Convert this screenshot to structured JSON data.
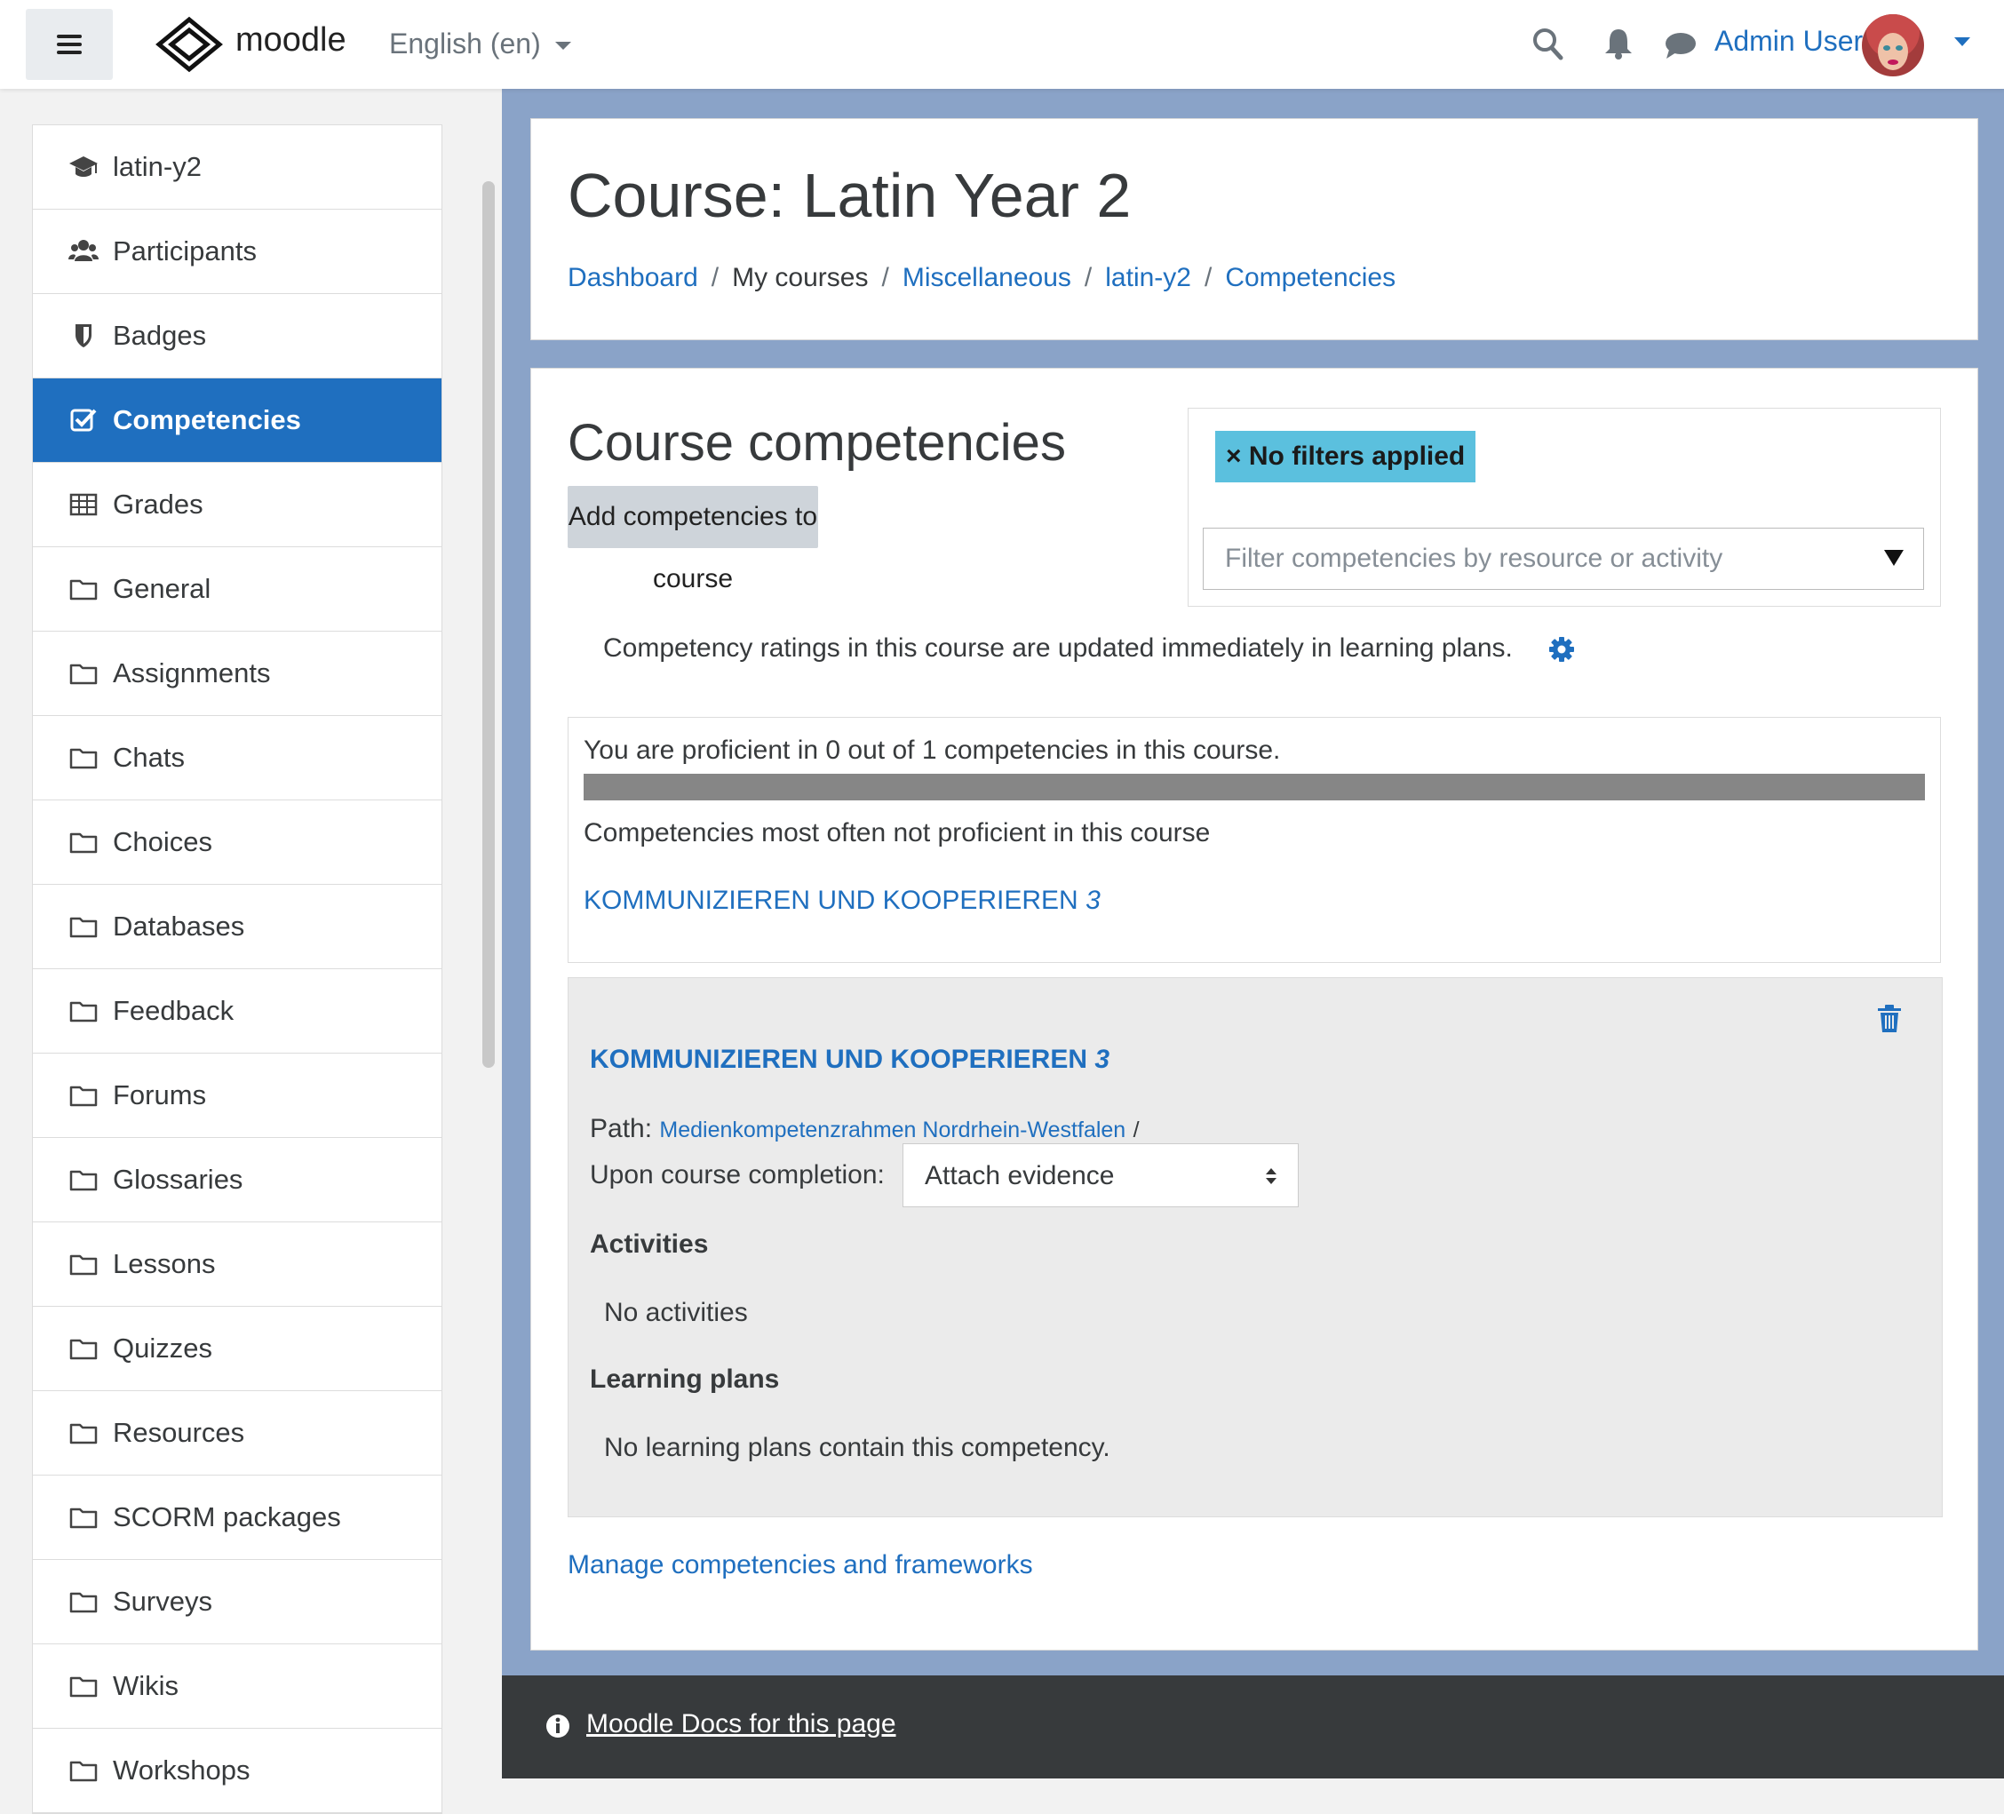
{
  "navbar": {
    "brand": "moodle",
    "language": "English (en)",
    "user_name": "Admin User"
  },
  "sidebar": {
    "items": [
      {
        "label": "latin-y2",
        "icon": "graduation-cap-icon",
        "active": false
      },
      {
        "label": "Participants",
        "icon": "users-icon",
        "active": false
      },
      {
        "label": "Badges",
        "icon": "shield-icon",
        "active": false
      },
      {
        "label": "Competencies",
        "icon": "check-square-icon",
        "active": true
      },
      {
        "label": "Grades",
        "icon": "table-icon",
        "active": false
      },
      {
        "label": "General",
        "icon": "folder-icon",
        "active": false
      },
      {
        "label": "Assignments",
        "icon": "folder-icon",
        "active": false
      },
      {
        "label": "Chats",
        "icon": "folder-icon",
        "active": false
      },
      {
        "label": "Choices",
        "icon": "folder-icon",
        "active": false
      },
      {
        "label": "Databases",
        "icon": "folder-icon",
        "active": false
      },
      {
        "label": "Feedback",
        "icon": "folder-icon",
        "active": false
      },
      {
        "label": "Forums",
        "icon": "folder-icon",
        "active": false
      },
      {
        "label": "Glossaries",
        "icon": "folder-icon",
        "active": false
      },
      {
        "label": "Lessons",
        "icon": "folder-icon",
        "active": false
      },
      {
        "label": "Quizzes",
        "icon": "folder-icon",
        "active": false
      },
      {
        "label": "Resources",
        "icon": "folder-icon",
        "active": false
      },
      {
        "label": "SCORM packages",
        "icon": "folder-icon",
        "active": false
      },
      {
        "label": "Surveys",
        "icon": "folder-icon",
        "active": false
      },
      {
        "label": "Wikis",
        "icon": "folder-icon",
        "active": false
      },
      {
        "label": "Workshops",
        "icon": "folder-icon",
        "active": false
      }
    ]
  },
  "header": {
    "title": "Course: Latin Year 2",
    "breadcrumb": {
      "dashboard": "Dashboard",
      "my_courses": "My courses",
      "category": "Miscellaneous",
      "course": "latin-y2",
      "current": "Competencies",
      "separator": "/"
    }
  },
  "main": {
    "heading": "Course competencies",
    "add_button": "Add competencies to course",
    "filter": {
      "tag_remove": "×",
      "tag_label": "No filters applied",
      "placeholder": "Filter competencies by resource or activity"
    },
    "ratings_note": "Competency ratings in this course are updated immediately in learning plans.",
    "summary": {
      "proficient_text": "You are proficient in 0 out of 1 competencies in this course.",
      "progress_fraction": 0,
      "most_often_label": "Competencies most often not proficient in this course",
      "link_text": "KOMMUNIZIEREN UND KOOPERIEREN",
      "link_number": "3"
    },
    "competency": {
      "title": "KOMMUNIZIEREN UND KOOPERIEREN",
      "title_number": "3",
      "path_label": "Path:",
      "path_link": "Medienkompetenzrahmen Nordrhein-Westfalen",
      "path_sep": "/",
      "upon_label": "Upon course completion:",
      "upon_value": "Attach evidence",
      "activities_heading": "Activities",
      "activities_text": "No activities",
      "plans_heading": "Learning plans",
      "plans_text": "No learning plans contain this competency."
    },
    "manage_link": "Manage competencies and frameworks"
  },
  "footer": {
    "docs_link": "Moodle Docs for this page"
  },
  "colors": {
    "accent": "#1f6fbf",
    "page_band": "#8aa3c8",
    "filter_tag": "#5bc0de",
    "footer": "#373a3c"
  }
}
